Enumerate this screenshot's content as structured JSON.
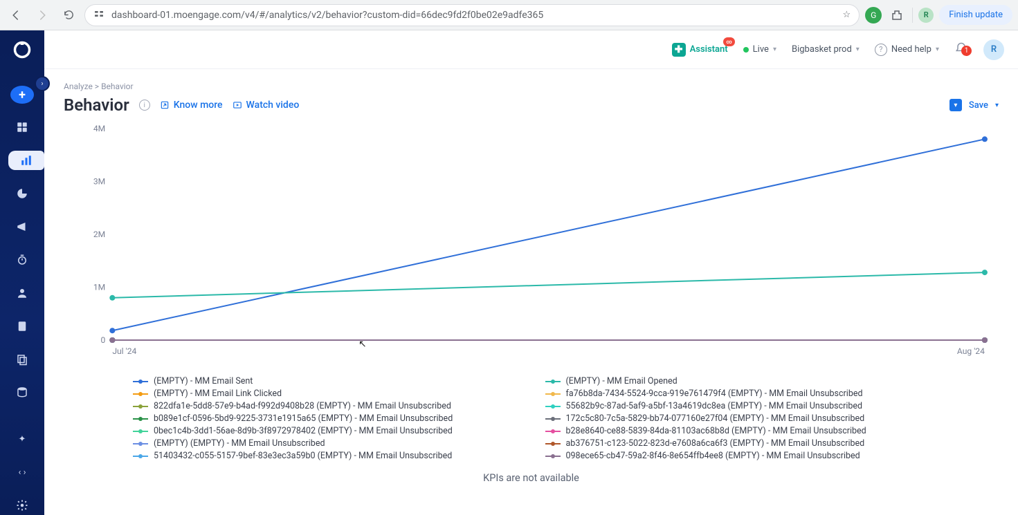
{
  "browser": {
    "url": "dashboard-01.moengage.com/v4/#/analytics/v2/behavior?custom-did=66dec9fd2f0be02e9adfe365",
    "finish_update": "Finish update",
    "avatar_g": "G",
    "avatar_r": "R"
  },
  "topbar": {
    "assistant": "Assistant",
    "live": "Live",
    "org": "Bigbasket prod",
    "help": "Need help",
    "notification_count": "1",
    "avatar": "R"
  },
  "breadcrumb": {
    "a": "Analyze",
    "sep": ">",
    "b": "Behavior"
  },
  "page": {
    "title": "Behavior",
    "know_more": "Know more",
    "watch_video": "Watch video",
    "save": "Save",
    "kpi_msg": "KPIs are not available"
  },
  "chart_data": {
    "type": "line",
    "categories": [
      "Jul '24",
      "Aug '24"
    ],
    "ylabel": "",
    "xlabel": "",
    "ylim": [
      0,
      4000000
    ],
    "yticks": [
      0,
      1000000,
      2000000,
      3000000,
      4000000
    ],
    "ytick_labels": [
      "0",
      "1M",
      "2M",
      "3M",
      "4M"
    ],
    "series": [
      {
        "name": "(EMPTY) - MM Email Sent",
        "color": "#2f6fd8",
        "values": [
          180000,
          3800000
        ]
      },
      {
        "name": "(EMPTY) - MM Email Opened",
        "color": "#2bb9a9",
        "values": [
          800000,
          1280000
        ]
      },
      {
        "name": "(EMPTY) - MM Email Link Clicked",
        "color": "#f39c12",
        "values": [
          0,
          0
        ]
      },
      {
        "name": "fa76b8da-7434-5524-9cca-919e761479f4 (EMPTY) - MM Email Unsubscribed",
        "color": "#f1b84b",
        "values": [
          0,
          0
        ]
      },
      {
        "name": "822dfa1e-5dd8-57e9-b4ad-f992d9408b28 (EMPTY) - MM Email Unsubscribed",
        "color": "#8aa23a",
        "values": [
          0,
          0
        ]
      },
      {
        "name": "55682b9c-87ad-5af9-a5bf-13a4619dc8ea (EMPTY) - MM Email Unsubscribed",
        "color": "#2fd0c0",
        "values": [
          0,
          0
        ]
      },
      {
        "name": "b089e1cf-0596-5bd9-9225-3731e1915a65 (EMPTY) - MM Email Unsubscribed",
        "color": "#2a9148",
        "values": [
          0,
          0
        ]
      },
      {
        "name": "172c5c80-7c5a-5829-bb74-077160e27f04 (EMPTY) - MM Email Unsubscribed",
        "color": "#6b6f7a",
        "values": [
          0,
          0
        ]
      },
      {
        "name": "0bec1c4b-3dd1-56ae-8d9b-3f8972978402 (EMPTY) - MM Email Unsubscribed",
        "color": "#42d39a",
        "values": [
          0,
          0
        ]
      },
      {
        "name": "b28e8640-ce88-5839-84da-81103ac68b8d (EMPTY) - MM Email Unsubscribed",
        "color": "#e54fa0",
        "values": [
          0,
          0
        ]
      },
      {
        "name": "(EMPTY) (EMPTY) - MM Email Unsubscribed",
        "color": "#6b8fe3",
        "values": [
          0,
          0
        ]
      },
      {
        "name": "ab376751-c123-5022-823d-e7608a6ca6f3 (EMPTY) - MM Email Unsubscribed",
        "color": "#b0572a",
        "values": [
          0,
          0
        ]
      },
      {
        "name": "51403432-c055-5157-9bef-83e3ec3a59b0 (EMPTY) - MM Email Unsubscribed",
        "color": "#4aa7e8",
        "values": [
          0,
          0
        ]
      },
      {
        "name": "098ece65-cb47-59a2-8f46-8e654ffb4ee8 (EMPTY) - MM Email Unsubscribed",
        "color": "#8a7090",
        "values": [
          0,
          0
        ]
      }
    ]
  }
}
